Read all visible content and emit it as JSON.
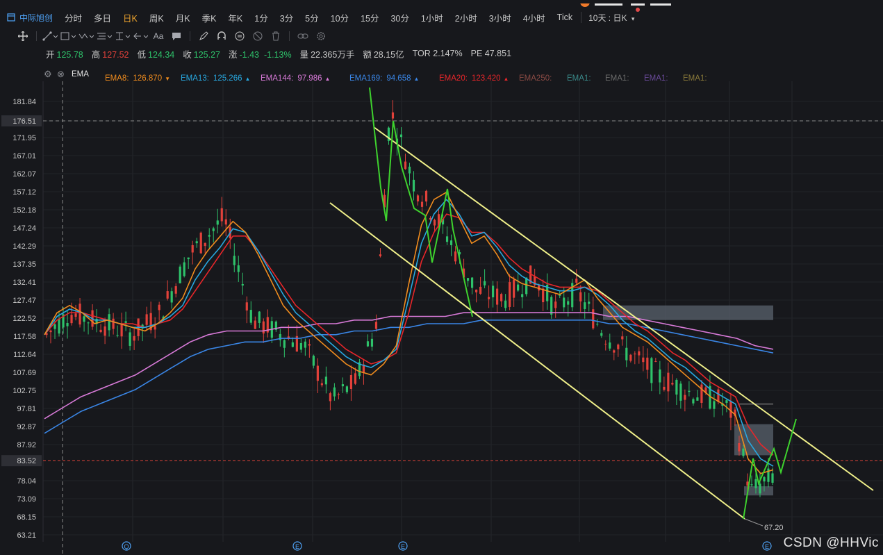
{
  "periodbar": {
    "stock_name": "中际旭创",
    "periods": [
      "分时",
      "多日",
      "日K",
      "周K",
      "月K",
      "季K",
      "年K",
      "1分",
      "3分",
      "5分",
      "10分",
      "15分",
      "30分",
      "1小时",
      "2小时",
      "3小时",
      "4小时",
      "Tick"
    ],
    "active_period": "日K",
    "range_select": "10天 : 日K"
  },
  "toolbar": {
    "tools": [
      "crosshair-icon",
      "line-tool-icon",
      "rect-tool-icon",
      "pattern-tool-icon",
      "fib-tool-icon",
      "measure-tool-icon",
      "arrow-tool-icon",
      "text-tool-icon",
      "comment-tool-icon",
      "pencil-icon",
      "magnet-icon",
      "lock-icon",
      "hide-icon",
      "trash-icon",
      "link-icon",
      "settings-icon"
    ]
  },
  "quote": {
    "open_label": "开",
    "open": "125.78",
    "high_label": "高",
    "high": "127.52",
    "low_label": "低",
    "low": "124.34",
    "close_label": "收",
    "close": "125.27",
    "change_label": "涨",
    "change": "-1.43",
    "change_pct": "-1.13%",
    "volume_label": "量",
    "volume": "22.365万手",
    "amount_label": "额",
    "amount": "28.15亿",
    "tor": "TOR 2.147%",
    "pe": "PE 47.851"
  },
  "ema": {
    "title": "EMA",
    "items": [
      {
        "label": "EMA8:",
        "value": "126.870",
        "color": "#f08c1e",
        "trend": "down"
      },
      {
        "label": "EMA13:",
        "value": "125.266",
        "color": "#28a8e0",
        "trend": "up"
      },
      {
        "label": "EMA144:",
        "value": "97.986",
        "color": "#d87ad8",
        "trend": "up"
      },
      {
        "label": "EMA169:",
        "value": "94.658",
        "color": "#3a86e6",
        "trend": "up"
      },
      {
        "label": "EMA20:",
        "value": "123.420",
        "color": "#e8262a",
        "trend": "up"
      },
      {
        "label": "EMA250:",
        "value": "",
        "color": "#8a4a44",
        "trend": ""
      },
      {
        "label": "EMA1:",
        "value": "",
        "color": "#3a8a8a",
        "trend": ""
      },
      {
        "label": "EMA1:",
        "value": "",
        "color": "#6a6a6a",
        "trend": ""
      },
      {
        "label": "EMA1:",
        "value": "",
        "color": "#6a4a9a",
        "trend": ""
      },
      {
        "label": "EMA1:",
        "value": "",
        "color": "#8a7a3a",
        "trend": ""
      }
    ]
  },
  "chart_data": {
    "type": "candlestick",
    "y_ticks": [
      "181.84",
      "176.51",
      "171.95",
      "167.01",
      "162.07",
      "157.12",
      "152.18",
      "147.24",
      "142.29",
      "137.35",
      "132.41",
      "127.47",
      "122.52",
      "117.58",
      "112.64",
      "107.69",
      "102.75",
      "97.81",
      "92.87",
      "87.92",
      "83.52",
      "78.04",
      "73.09",
      "68.15",
      "63.21"
    ],
    "highlight_price_top": "176.51",
    "current_price": "83.52",
    "current_price_color": "#e2413a",
    "ylim": [
      60,
      186
    ],
    "low_annotation": "67.20",
    "event_markers": [
      "Q",
      "E",
      "E",
      "E"
    ],
    "colors": {
      "up": "#e2413a",
      "down": "#2ec26a",
      "ema8": "#f08c1e",
      "ema13": "#28a8e0",
      "ema20": "#e8262a",
      "ema144": "#d87ad8",
      "ema169": "#3a86e6",
      "channel": "#f0f08a",
      "drawing": "#3ed22e",
      "zone": "#5a626c"
    },
    "series": [
      {
        "name": "EMA8",
        "values": [
          118,
          124,
          126,
          124,
          121,
          122,
          121,
          120,
          119,
          121,
          124,
          128,
          136,
          141,
          145,
          149,
          146,
          140,
          133,
          126,
          122,
          119,
          116,
          113,
          110,
          108,
          107,
          110,
          115,
          132,
          148,
          155,
          157,
          150,
          143,
          145,
          140,
          134,
          132,
          131,
          130,
          129,
          131,
          133,
          128,
          124,
          120,
          118,
          116,
          113,
          110,
          107,
          104,
          101,
          99,
          96,
          84,
          80,
          81
        ]
      },
      {
        "name": "EMA13",
        "values": [
          118,
          123,
          125,
          124,
          122,
          122,
          121,
          120,
          120,
          121,
          123,
          126,
          133,
          138,
          142,
          147,
          146,
          141,
          135,
          129,
          124,
          121,
          118,
          115,
          112,
          110,
          109,
          111,
          114,
          128,
          143,
          151,
          155,
          151,
          145,
          146,
          142,
          137,
          134,
          132,
          131,
          130,
          130,
          131,
          129,
          126,
          122,
          119,
          117,
          114,
          111,
          109,
          106,
          103,
          101,
          99,
          89,
          84,
          82
        ]
      },
      {
        "name": "EMA20",
        "values": [
          118,
          122,
          124,
          124,
          123,
          122,
          121,
          121,
          120,
          121,
          122,
          125,
          130,
          135,
          140,
          145,
          145,
          141,
          136,
          131,
          126,
          123,
          120,
          117,
          114,
          112,
          110,
          111,
          113,
          124,
          138,
          146,
          151,
          150,
          146,
          146,
          143,
          139,
          136,
          134,
          132,
          131,
          131,
          131,
          130,
          127,
          124,
          121,
          119,
          116,
          113,
          111,
          108,
          105,
          103,
          101,
          93,
          88,
          85
        ]
      },
      {
        "name": "EMA144",
        "values": [
          95,
          98,
          101,
          103,
          105,
          107,
          110,
          113,
          116,
          118,
          119,
          119,
          119,
          120,
          120,
          121,
          121,
          122,
          122,
          123,
          123,
          123,
          123,
          124,
          124,
          124,
          124,
          124,
          124,
          124,
          124,
          123,
          123,
          122,
          121,
          120,
          119,
          118,
          117,
          115,
          114
        ]
      },
      {
        "name": "EMA169",
        "values": [
          91,
          94,
          97,
          99,
          101,
          103,
          106,
          109,
          112,
          114,
          115,
          116,
          116,
          117,
          117,
          118,
          118,
          119,
          119,
          120,
          120,
          121,
          121,
          121,
          122,
          122,
          122,
          122,
          122,
          122,
          122,
          121,
          121,
          120,
          119,
          118,
          117,
          116,
          115,
          114,
          113
        ]
      }
    ]
  },
  "watermark": "CSDN @HHVic"
}
